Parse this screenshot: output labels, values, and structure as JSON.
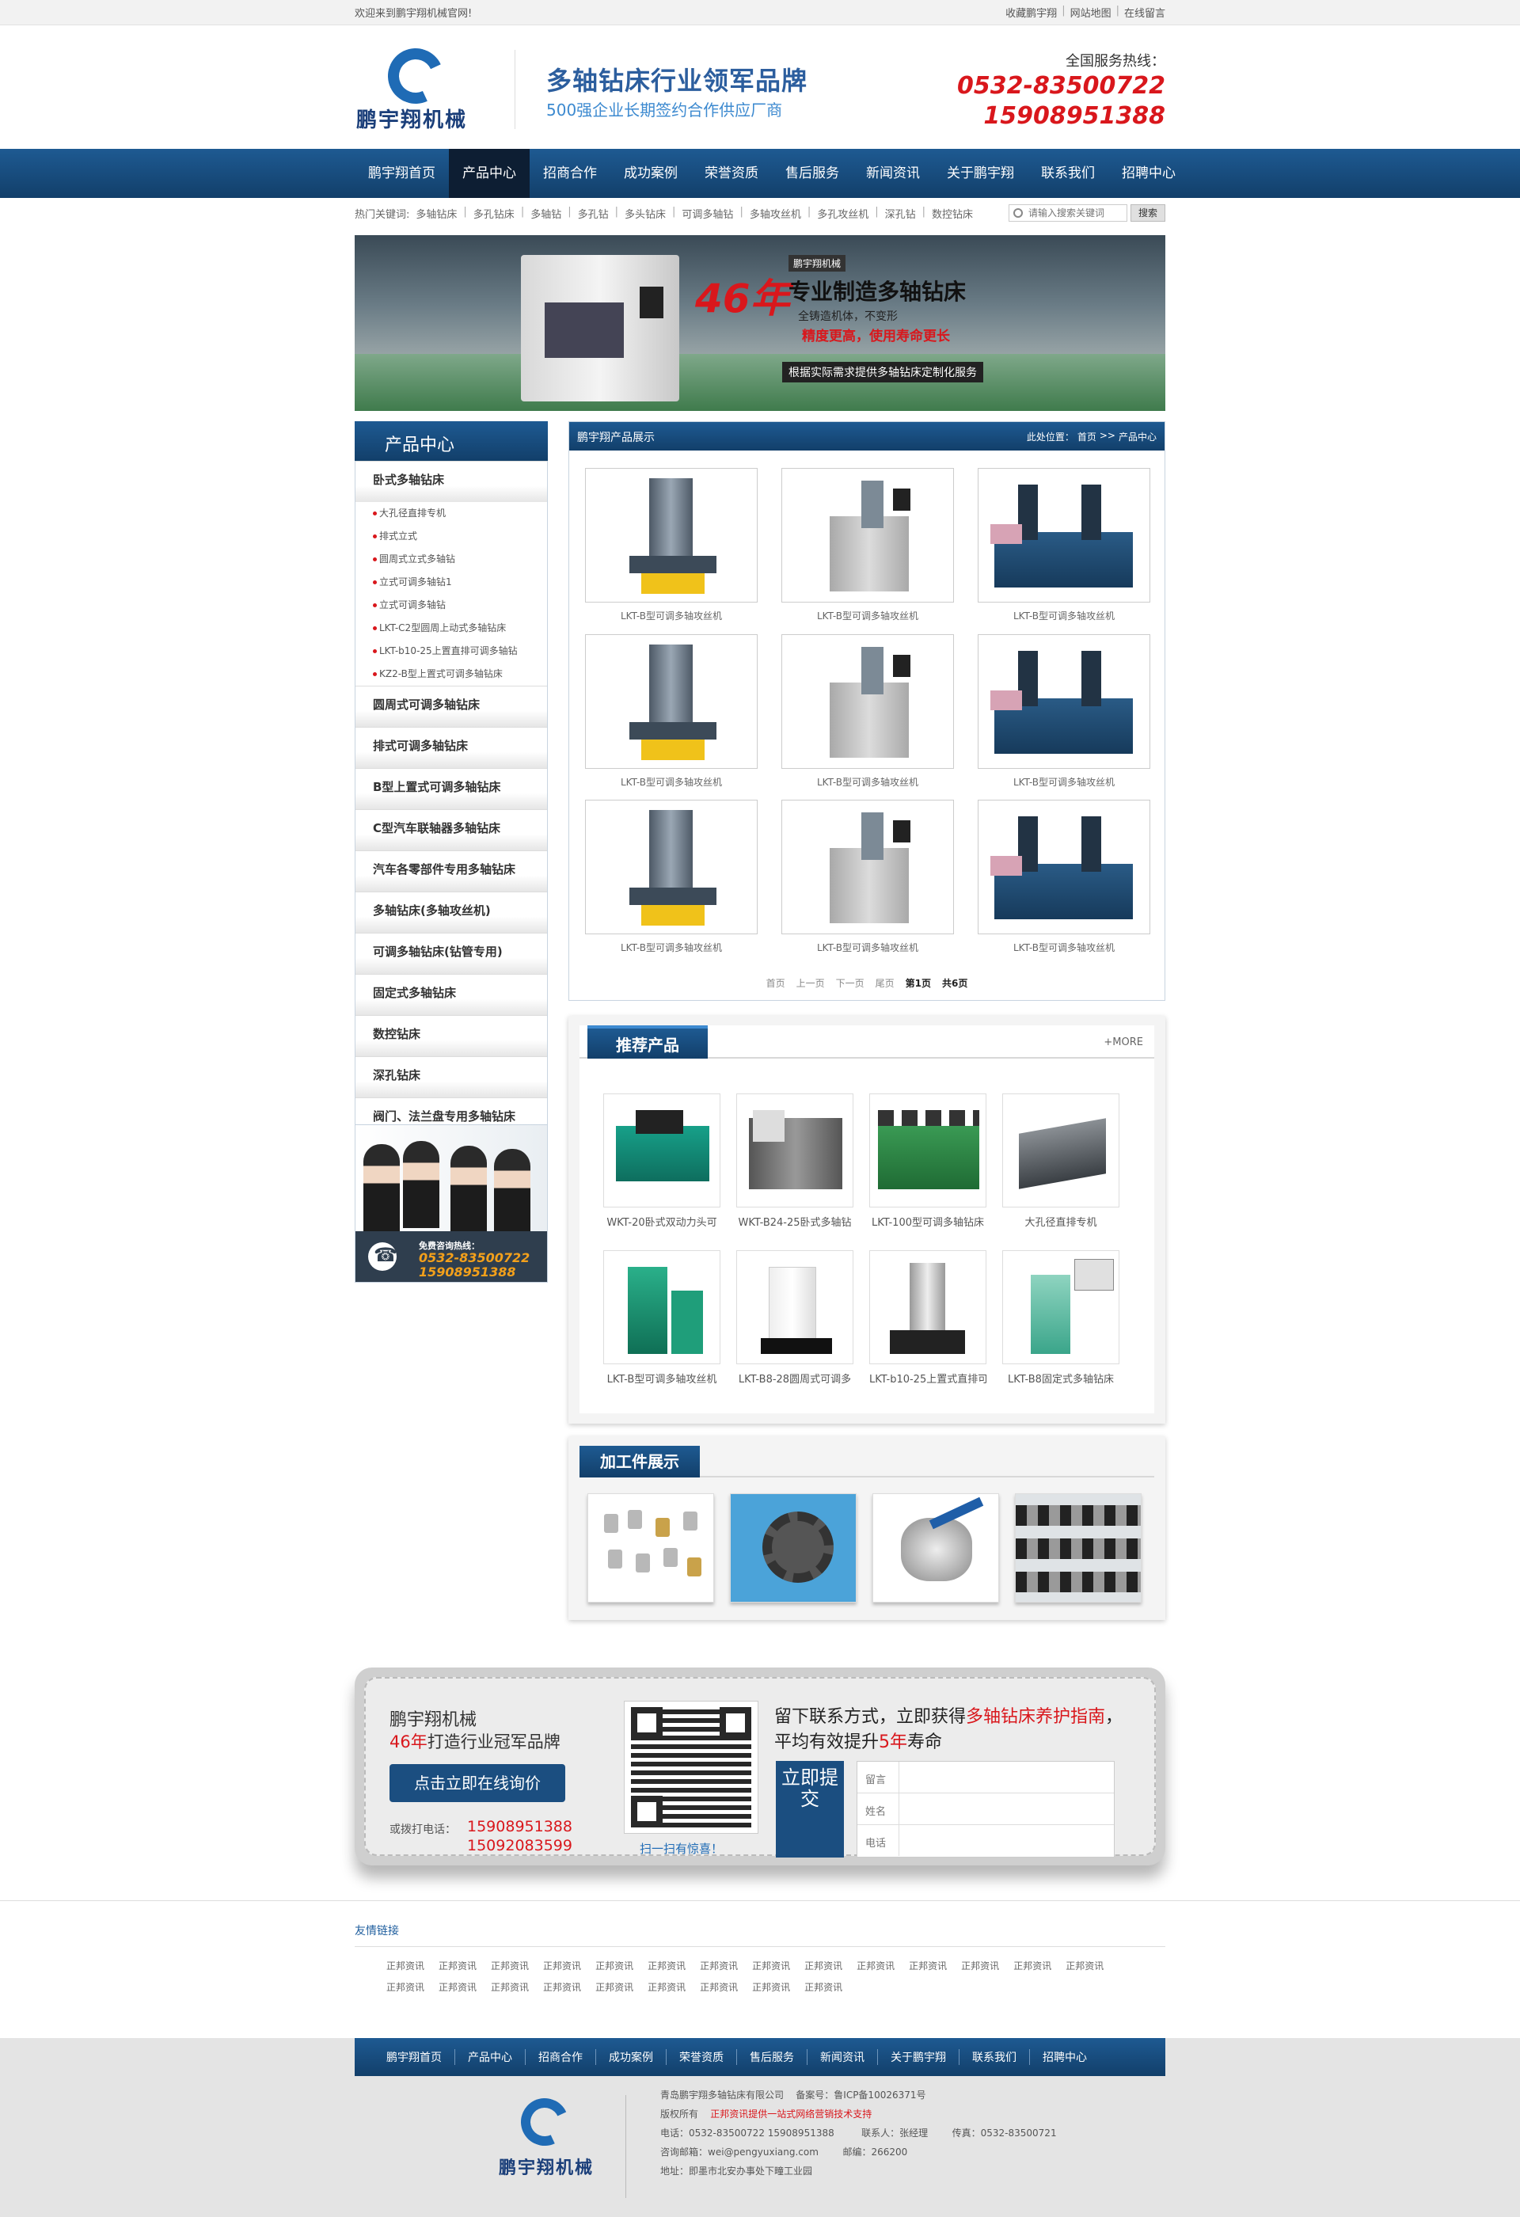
{
  "topbar": {
    "welcome": "欢迎来到鹏宇翔机械官网!",
    "links": [
      "收藏鹏宇翔",
      "网站地图",
      "在线留言"
    ]
  },
  "header": {
    "brand": "鹏宇翔机械",
    "slogan_main": "多轴钻床行业领军品牌",
    "slogan_sub": "500强企业长期签约合作供应厂商",
    "hotline_label": "全国服务热线：",
    "phone1": "0532-83500722",
    "phone2": "15908951388"
  },
  "nav": [
    "鹏宇翔首页",
    "产品中心",
    "招商合作",
    "成功案例",
    "荣誉资质",
    "售后服务",
    "新闻资讯",
    "关于鹏宇翔",
    "联系我们",
    "招聘中心"
  ],
  "keywords": {
    "label": "热门关键词:",
    "items": [
      "多轴钻床",
      "多孔钻床",
      "多轴钻",
      "多孔钻",
      "多头钻床",
      "可调多轴钻",
      "多轴攻丝机",
      "多孔攻丝机",
      "深孔钻",
      "数控钻床"
    ]
  },
  "search": {
    "placeholder": "请输入搜索关键词",
    "button": "搜索"
  },
  "banner": {
    "badge": "鹏宇翔机械",
    "years": "46年",
    "headline": "专业制造多轴钻床",
    "line2": "全铸造机体，不变形",
    "line3": "精度更高，使用寿命更长",
    "line4": "根据实际需求提供多轴钻床定制化服务"
  },
  "sidebar": {
    "title": "产品中心",
    "first_category": "卧式多轴钻床",
    "sub_items": [
      "大孔径直排专机",
      "排式立式",
      "圆周式立式多轴钻",
      "立式可调多轴钻1",
      "立式可调多轴钻",
      "LKT-C2型圆周上动式多轴钻床",
      "LKT-b10-25上置直排可调多轴钻",
      "KZ2-B型上置式可调多轴钻床"
    ],
    "categories": [
      "圆周式可调多轴钻床",
      "排式可调多轴钻床",
      "B型上置式可调多轴钻床",
      "C型汽车联轴器多轴钻床",
      "汽车各零部件专用多轴钻床",
      "多轴钻床(多轴攻丝机)",
      "可调多轴钻床(钻管专用)",
      "固定式多轴钻床",
      "数控钻床",
      "深孔钻床",
      "阀门、法兰盘专用多轴钻床"
    ],
    "cs_label": "免费咨询热线：",
    "cs_phone1": "0532-83500722",
    "cs_phone2": "15908951388"
  },
  "products": {
    "title": "鹏宇翔产品展示",
    "breadcrumb_label": "此处位置：",
    "breadcrumb": [
      "首页",
      ">>",
      "产品中心"
    ],
    "items": [
      {
        "caption": "LKT-B型可调多轴攻丝机",
        "img": "machine-blue"
      },
      {
        "caption": "LKT-B型可调多轴攻丝机",
        "img": "machine-grey"
      },
      {
        "caption": "LKT-B型可调多轴攻丝机",
        "img": "machine-navy"
      },
      {
        "caption": "LKT-B型可调多轴攻丝机",
        "img": "machine-blue"
      },
      {
        "caption": "LKT-B型可调多轴攻丝机",
        "img": "machine-grey"
      },
      {
        "caption": "LKT-B型可调多轴攻丝机",
        "img": "machine-navy"
      },
      {
        "caption": "LKT-B型可调多轴攻丝机",
        "img": "machine-blue"
      },
      {
        "caption": "LKT-B型可调多轴攻丝机",
        "img": "machine-grey"
      },
      {
        "caption": "LKT-B型可调多轴攻丝机",
        "img": "machine-navy"
      }
    ],
    "pager": [
      "首页",
      "上一页",
      "下一页",
      "尾页",
      "第1页",
      "共6页"
    ]
  },
  "recommend": {
    "title": "推荐产品",
    "more": "+MORE",
    "items": [
      "WKT-20卧式双动力头可",
      "WKT-B24-25卧式多轴钻",
      "LKT-100型可调多轴钻床",
      "大孔径直排专机",
      "LKT-B型可调多轴攻丝机",
      "LKT-B8-28圆周式可调多",
      "LKT-b10-25上置式直排可",
      "LKT-B8固定式多轴钻床"
    ]
  },
  "parts": {
    "title": "加工件展示"
  },
  "contact": {
    "brand": "鹏宇翔机械",
    "slogan_years": "46年",
    "slogan_rest": "打造行业冠军品牌",
    "button": "点击立即在线询价",
    "tel_label": "或拨打电话：",
    "tel1": "15908951388",
    "tel2": "15092083599",
    "scan": "扫一扫有惊喜！",
    "pitch1_a": "留下联系方式，立即获得",
    "pitch1_red": "多轴钻床养护指南",
    "pitch1_b": "，",
    "pitch2_a": "平均有效提升",
    "pitch2_red": "5年",
    "pitch2_b": "寿命",
    "submit": "立即提交",
    "fields": [
      "留言",
      "姓名",
      "电话"
    ]
  },
  "friend_links": {
    "title": "友情链接",
    "items": [
      "正邦资讯",
      "正邦资讯",
      "正邦资讯",
      "正邦资讯",
      "正邦资讯",
      "正邦资讯",
      "正邦资讯",
      "正邦资讯",
      "正邦资讯",
      "正邦资讯",
      "正邦资讯",
      "正邦资讯",
      "正邦资讯",
      "正邦资讯",
      "正邦资讯",
      "正邦资讯",
      "正邦资讯",
      "正邦资讯",
      "正邦资讯",
      "正邦资讯",
      "正邦资讯",
      "正邦资讯",
      "正邦资讯"
    ]
  },
  "footer": {
    "nav": [
      "鹏宇翔首页",
      "产品中心",
      "招商合作",
      "成功案例",
      "荣誉资质",
      "售后服务",
      "新闻资讯",
      "关于鹏宇翔",
      "联系我们",
      "招聘中心"
    ],
    "brand": "鹏宇翔机械",
    "company": "青岛鹏宇翔多轴钻床有限公司",
    "icp": "备案号：鲁ICP备10026371号",
    "copyright": "版权所有",
    "support": "正邦资讯提供一站式网络营销技术支持",
    "tel": "电话：0532-83500722  15908951388",
    "contact_person": "联系人：张经理",
    "fax": "传真：0532-83500721",
    "email": "咨询邮箱：wei@pengyuxiang.com",
    "postcode": "邮编：266200",
    "address": "地址：即墨市北安办事处下疃工业园"
  },
  "colors": {
    "primary": "#1b4e80",
    "accent": "#d9171c",
    "nav_active": "#0d1e33"
  }
}
